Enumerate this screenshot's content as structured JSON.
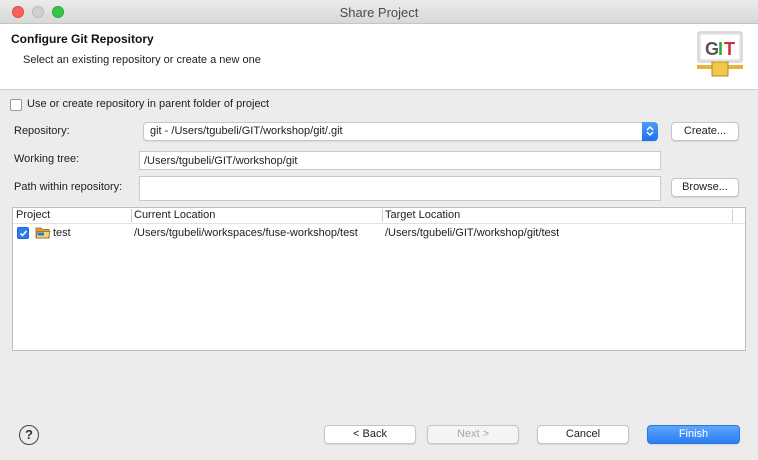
{
  "window": {
    "title": "Share Project"
  },
  "header": {
    "title": "Configure Git Repository",
    "subtitle": "Select an existing repository or create a new one",
    "icon": "git-logo-icon",
    "icon_text": "GIT"
  },
  "parent_repo_option": {
    "label": "Use or create repository in parent folder of project",
    "checked": false
  },
  "repository": {
    "label": "Repository:",
    "value": "git - /Users/tgubeli/GIT/workshop/git/.git",
    "create_button": "Create..."
  },
  "working_tree": {
    "label": "Working tree:",
    "value": "/Users/tgubeli/GIT/workshop/git"
  },
  "path_within": {
    "label": "Path within repository:",
    "value": "",
    "browse_button": "Browse..."
  },
  "table": {
    "columns": [
      "Project",
      "Current Location",
      "Target Location"
    ],
    "rows": [
      {
        "checked": true,
        "project": "test",
        "current": "/Users/tgubeli/workspaces/fuse-workshop/test",
        "target": "/Users/tgubeli/GIT/workshop/git/test"
      }
    ]
  },
  "footer": {
    "help_icon": "help-icon",
    "help_glyph": "?",
    "back": "< Back",
    "next": "Next >",
    "cancel": "Cancel",
    "finish": "Finish"
  },
  "colors": {
    "accent": "#2a7df3",
    "traffic_red": "#fc605c",
    "traffic_green": "#34c749"
  }
}
